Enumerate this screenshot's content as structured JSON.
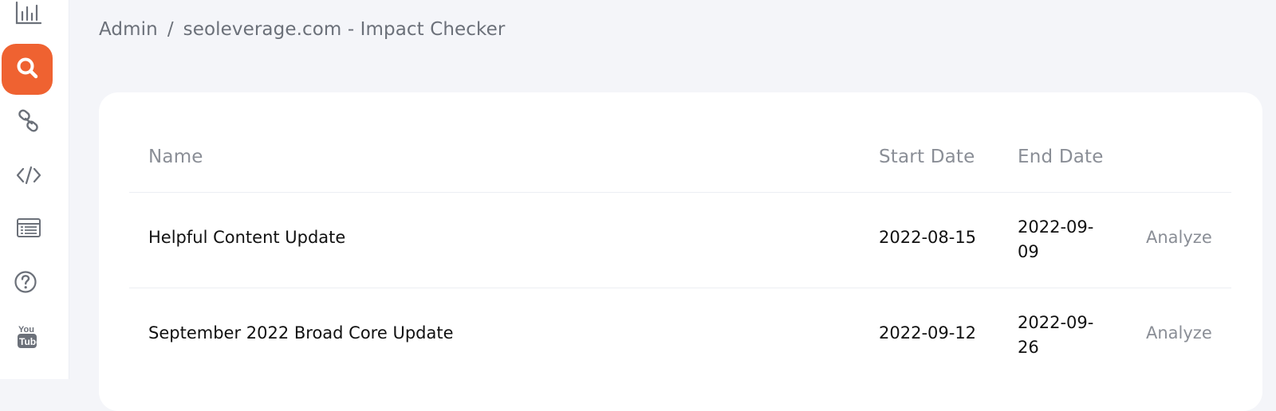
{
  "sidebar": {
    "items": [
      {
        "icon": "bar-chart-icon"
      },
      {
        "icon": "search-icon",
        "active": true
      },
      {
        "icon": "link-icon"
      },
      {
        "icon": "code-icon"
      },
      {
        "icon": "list-window-icon"
      },
      {
        "icon": "help-icon"
      },
      {
        "icon": "youtube-icon"
      }
    ],
    "accent": "#ef6231"
  },
  "breadcrumb": {
    "root": "Admin",
    "separator": "/",
    "current": "seoleverage.com - Impact Checker"
  },
  "table": {
    "columns": [
      "Name",
      "Start Date",
      "End Date"
    ],
    "rows": [
      {
        "name": "Helpful Content Update",
        "start": "2022-08-15",
        "end": "2022-09-09",
        "action": "Analyze"
      },
      {
        "name": "September 2022 Broad Core Update",
        "start": "2022-09-12",
        "end": "2022-09-26",
        "action": "Analyze"
      }
    ]
  }
}
